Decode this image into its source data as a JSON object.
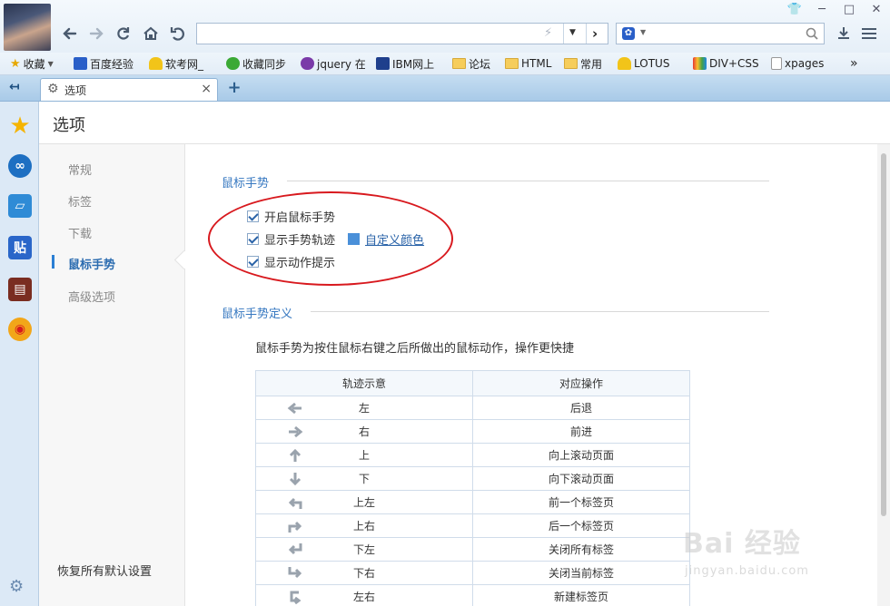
{
  "toolbar": {
    "back_icon": "arrow-left-icon",
    "forward_icon": "arrow-right-icon",
    "refresh_icon": "refresh-icon",
    "home_icon": "home-icon",
    "undo_icon": "undo-close-icon"
  },
  "address": {
    "value": "",
    "placeholder": ""
  },
  "search": {
    "value": "",
    "placeholder": ""
  },
  "bookmarks": [
    {
      "label": "收藏",
      "icon": "star-icon"
    },
    {
      "label": "百度经验",
      "icon": "baidu-paw-icon"
    },
    {
      "label": "软考网_",
      "icon": "trophy-icon"
    },
    {
      "label": "收藏同步",
      "icon": "sync-e-icon"
    },
    {
      "label": "jquery 在",
      "icon": "gear-bug-icon"
    },
    {
      "label": "IBM网上",
      "icon": "ibm-icon"
    },
    {
      "label": "论坛",
      "icon": "folder-icon"
    },
    {
      "label": "HTML",
      "icon": "folder-icon"
    },
    {
      "label": "常用",
      "icon": "folder-icon"
    },
    {
      "label": "LOTUS",
      "icon": "trophy-icon"
    },
    {
      "label": "DIV+CSS",
      "icon": "colorful-5-icon"
    },
    {
      "label": "xpages",
      "icon": "page-icon"
    },
    {
      "label": "»",
      "icon": "more-chevron-icon"
    }
  ],
  "tab": {
    "label": "选项",
    "close": "×",
    "new": "+"
  },
  "page": {
    "title": "选项",
    "restore_defaults": "恢复所有默认设置"
  },
  "nav": {
    "items": [
      {
        "label": "常规"
      },
      {
        "label": "标签"
      },
      {
        "label": "下载"
      },
      {
        "label": "鼠标手势"
      },
      {
        "label": "高级选项"
      }
    ],
    "active_index": 3
  },
  "mouse_gesture": {
    "section_title": "鼠标手势",
    "options": [
      {
        "label": "开启鼠标手势",
        "checked": true
      },
      {
        "label": "显示手势轨迹",
        "checked": true
      },
      {
        "label": "显示动作提示",
        "checked": true
      }
    ],
    "custom_color_label": "自定义颜色",
    "custom_color": "#4a90d9"
  },
  "gesture_definition": {
    "section_title": "鼠标手势定义",
    "description": "鼠标手势为按住鼠标右键之后所做出的鼠标动作，操作更快捷",
    "headers": [
      "轨迹示意",
      "对应操作"
    ],
    "rows": [
      {
        "gesture": "左",
        "action": "后退",
        "icon": "arrow-left"
      },
      {
        "gesture": "右",
        "action": "前进",
        "icon": "arrow-right"
      },
      {
        "gesture": "上",
        "action": "向上滚动页面",
        "icon": "arrow-up"
      },
      {
        "gesture": "下",
        "action": "向下滚动页面",
        "icon": "arrow-down"
      },
      {
        "gesture": "上左",
        "action": "前一个标签页",
        "icon": "arrow-up-left"
      },
      {
        "gesture": "上右",
        "action": "后一个标签页",
        "icon": "arrow-up-right"
      },
      {
        "gesture": "下左",
        "action": "关闭所有标签",
        "icon": "arrow-down-left"
      },
      {
        "gesture": "下右",
        "action": "关闭当前标签",
        "icon": "arrow-down-right"
      },
      {
        "gesture": "左右",
        "action": "新建标签页",
        "icon": "arrow-left-right"
      }
    ]
  },
  "watermark": {
    "logo": "Bai 经验",
    "url": "jingyan.baidu.com"
  },
  "colors": {
    "accent": "#2b7fd4",
    "highlight_ring": "#d8191e",
    "tabstrip": "#b6d3ee"
  }
}
